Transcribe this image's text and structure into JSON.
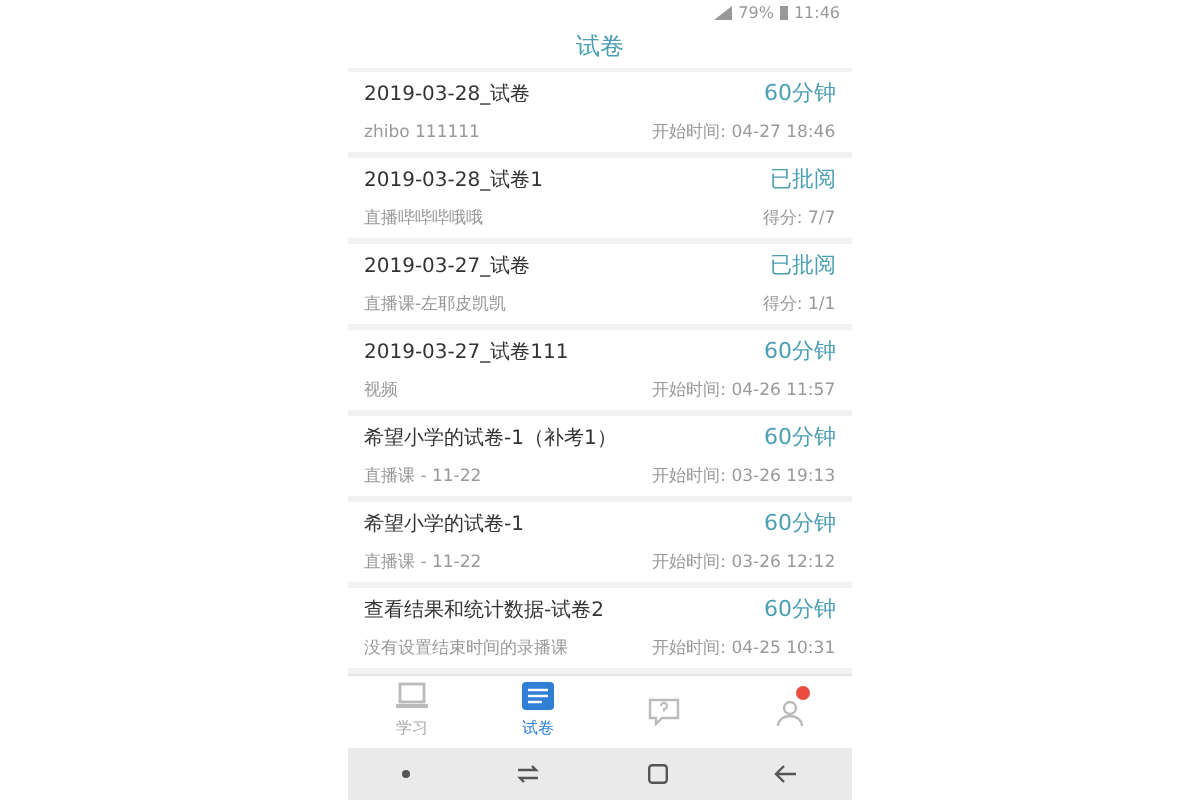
{
  "status_bar": {
    "battery": "79%",
    "time": "11:46"
  },
  "title": "试卷",
  "papers": [
    {
      "title": "2019-03-28_试卷",
      "subtitle": "zhibo 111111",
      "status": "60分钟",
      "info": "开始时间: 04-27 18:46"
    },
    {
      "title": "2019-03-28_试卷1",
      "subtitle": "直播哔哔哔哦哦",
      "status": "已批阅",
      "info": "得分: 7/7"
    },
    {
      "title": "2019-03-27_试卷",
      "subtitle": "直播课-左耶皮凯凯",
      "status": "已批阅",
      "info": "得分: 1/1"
    },
    {
      "title": "2019-03-27_试卷111",
      "subtitle": "视频",
      "status": "60分钟",
      "info": "开始时间: 04-26 11:57"
    },
    {
      "title": "希望小学的试卷-1（补考1）",
      "subtitle": "直播课 - 11-22",
      "status": "60分钟",
      "info": "开始时间: 03-26 19:13"
    },
    {
      "title": "希望小学的试卷-1",
      "subtitle": "直播课 - 11-22",
      "status": "60分钟",
      "info": "开始时间: 03-26 12:12"
    },
    {
      "title": "查看结果和统计数据-试卷2",
      "subtitle": "没有设置结束时间的录播课",
      "status": "60分钟",
      "info": "开始时间: 04-25 10:31"
    }
  ],
  "tabs": [
    {
      "label": "学习",
      "kind": "laptop",
      "selected": false
    },
    {
      "label": "试卷",
      "kind": "list",
      "selected": true
    },
    {
      "kind": "question",
      "selected": false
    },
    {
      "kind": "person",
      "selected": false,
      "badge": true
    }
  ]
}
